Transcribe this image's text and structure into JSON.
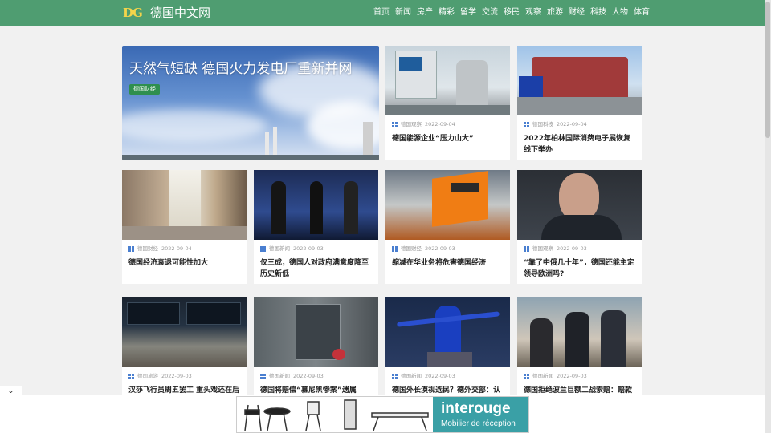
{
  "header": {
    "logo_text": "DG",
    "site_title": "德国中文网",
    "nav": [
      "首页",
      "新闻",
      "房产",
      "精彩",
      "留学",
      "交流",
      "移民",
      "观察",
      "旅游",
      "财经",
      "科技",
      "人物",
      "体育"
    ]
  },
  "hero": {
    "title": "天然气短缺 德国火力发电厂重新并网",
    "tag": "德国财经"
  },
  "cards": [
    {
      "category": "德国观察",
      "date": "2022-09-04",
      "title": "德国能源企业“压力山大”"
    },
    {
      "category": "德国科技",
      "date": "2022-09-04",
      "title": "2022年柏林国际消费电子展恢复线下举办"
    },
    {
      "category": "德国财经",
      "date": "2022-09-04",
      "title": "德国经济衰退可能性加大"
    },
    {
      "category": "德国新闻",
      "date": "2022-09-03",
      "title": "仅三成，德国人对政府满意度降至历史新低"
    },
    {
      "category": "德国财经",
      "date": "2022-09-03",
      "title": "缩减在华业务将危害德国经济"
    },
    {
      "category": "德国观察",
      "date": "2022-09-03",
      "title": "“靠了中俄几十年”，德国还能主定领导欧洲吗?"
    },
    {
      "category": "德国旅游",
      "date": "2022-09-03",
      "title": "汉莎飞行员周五罢工 重头戏还在后"
    },
    {
      "category": "德国新闻",
      "date": "2022-09-03",
      "title": "德国将赔偿“慕尼黑惨案”遗属"
    },
    {
      "category": "德国新闻",
      "date": "2022-09-03",
      "title": "德国外长漠视选民？德外交部：认"
    },
    {
      "category": "德国新闻",
      "date": "2022-09-03",
      "title": "德国拒绝波兰巨额二战索赔：赔款"
    }
  ],
  "ad": {
    "brand": "interouge",
    "subtitle": "Mobilier de réception"
  },
  "collapse_icon": "chevron-down-icon",
  "colors": {
    "header": "#4f9d71",
    "logo": "#f3d44b",
    "tag": "#2f8f4e"
  }
}
